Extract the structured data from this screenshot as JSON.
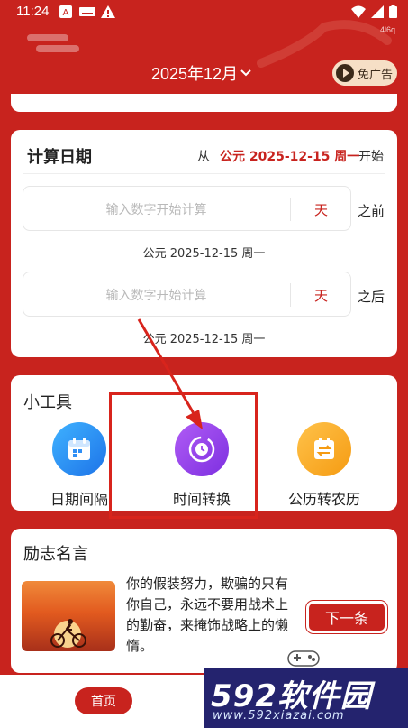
{
  "status_bar": {
    "time": "11:24",
    "network_label": "4l6q"
  },
  "header": {
    "title": "2025年12月",
    "ad_button": "免广告"
  },
  "calc": {
    "title": "计算日期",
    "from_label": "从",
    "from_date": "公元 2025-12-15 周一",
    "start_label": "开始",
    "before": {
      "placeholder": "输入数字开始计算",
      "unit": "天",
      "side_label": "之前",
      "result": "公元 2025-12-15 周一"
    },
    "after": {
      "placeholder": "输入数字开始计算",
      "unit": "天",
      "side_label": "之后",
      "result": "公元 2025-12-15 周一"
    }
  },
  "tools": {
    "title": "小工具",
    "items": [
      {
        "label": "日期间隔",
        "icon": "calendar-icon",
        "color": "#2f8ff5"
      },
      {
        "label": "时间转换",
        "icon": "clock-cycle-icon",
        "color": "#9a45ec"
      },
      {
        "label": "公历转农历",
        "icon": "calendar-swap-icon",
        "color": "#f7a520"
      }
    ]
  },
  "quotes": {
    "title": "励志名言",
    "text": "你的假装努力，欺骗的只有你自己，永远不要用战术上的勤奋，来掩饰战略上的懒惰。",
    "next_button": "下一条"
  },
  "bottom_nav": {
    "home": "首页"
  },
  "watermark": {
    "brand": "592软件园",
    "url": "www.592xiazai.com"
  },
  "colors": {
    "primary": "#c8231e",
    "ad_bg": "#f6dfc6",
    "annotation": "#d8241c"
  }
}
